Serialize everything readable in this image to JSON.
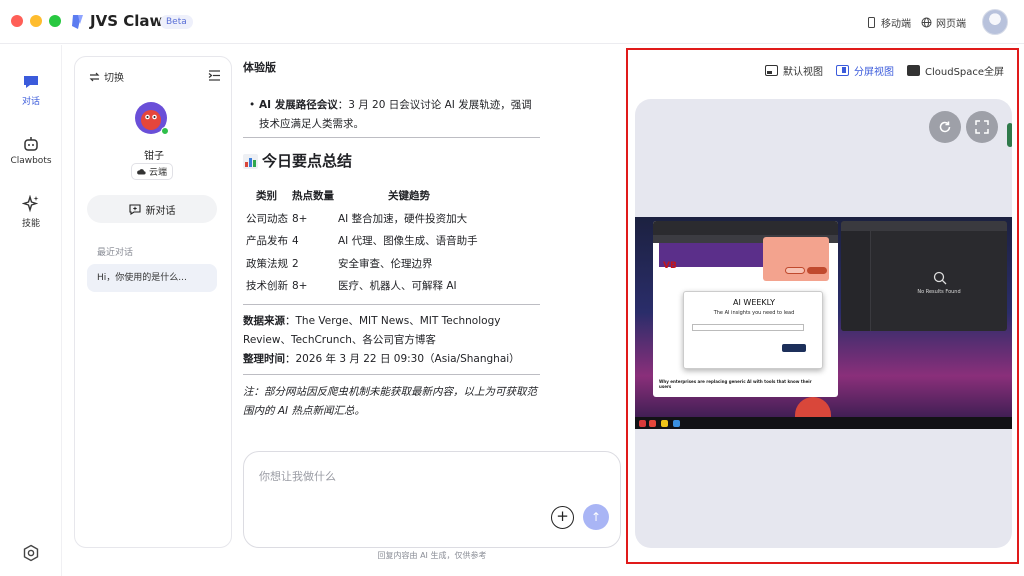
{
  "app": {
    "title": "JVS Claw",
    "badge": "Beta"
  },
  "topbar": {
    "mobile_label": "移动端",
    "web_label": "网页端"
  },
  "nav": [
    {
      "label": "对话",
      "icon": "chat-icon",
      "active": true
    },
    {
      "label": "Clawbots",
      "icon": "bot-icon",
      "active": false
    },
    {
      "label": "技能",
      "icon": "sparkle-icon",
      "active": false
    }
  ],
  "sessions": {
    "switch_label": "切换",
    "bot_name": "钳子",
    "cloud_label": "云端",
    "new_chat_label": "新对话",
    "recent_label": "最近对话",
    "recent_items": [
      "Hi，你使用的是什么..."
    ]
  },
  "chat": {
    "section_title": "体验版",
    "bullet_bold": "AI 发展路径会议",
    "bullet_text": "：3 月 20 日会议讨论 AI 发展轨迹，强调技术应满足人类需求。",
    "summary_title": "今日要点总结",
    "table_headers": [
      "类别",
      "热点数量",
      "关键趋势"
    ],
    "table_rows": [
      [
        "公司动态",
        "8+",
        "AI 整合加速，硬件投资加大"
      ],
      [
        "产品发布",
        "4",
        "AI 代理、图像生成、语音助手"
      ],
      [
        "政策法规",
        "2",
        "安全审查、伦理边界"
      ],
      [
        "技术创新",
        "8+",
        "医疗、机器人、可解释 AI"
      ]
    ],
    "sources_label": "数据来源",
    "sources_text": "：The Verge、MIT News、MIT Technology Review、TechCrunch、各公司官方博客",
    "time_label": "整理时间",
    "time_text": "：2026 年 3 月 22 日 09:30（Asia/Shanghai）",
    "note": "注：部分网站因反爬虫机制未能获取最新内容，以上为可获取范围内的 AI 热点新闻汇总。"
  },
  "input": {
    "placeholder": "你想让我做什么",
    "plus": "+",
    "send": "↑"
  },
  "disclaimer": "回复内容由 AI 生成，仅供参考",
  "views": {
    "default": "默认视图",
    "split": "分屏视图",
    "fullscreen": "CloudSpace全屏"
  },
  "preview": {
    "browser_logo": "VB",
    "weekly_title": "AI WEEKLY",
    "weekly_subtitle": "The AI insights you need to lead",
    "headline": "Why enterprises are replacing generic AI with tools that know their users",
    "file_message": "No Results Found"
  },
  "colors": {
    "accent": "#3b5bdb",
    "highlight_border": "#e01a1a",
    "send_button": "#a9b5f5",
    "online": "#2fbf4a"
  }
}
